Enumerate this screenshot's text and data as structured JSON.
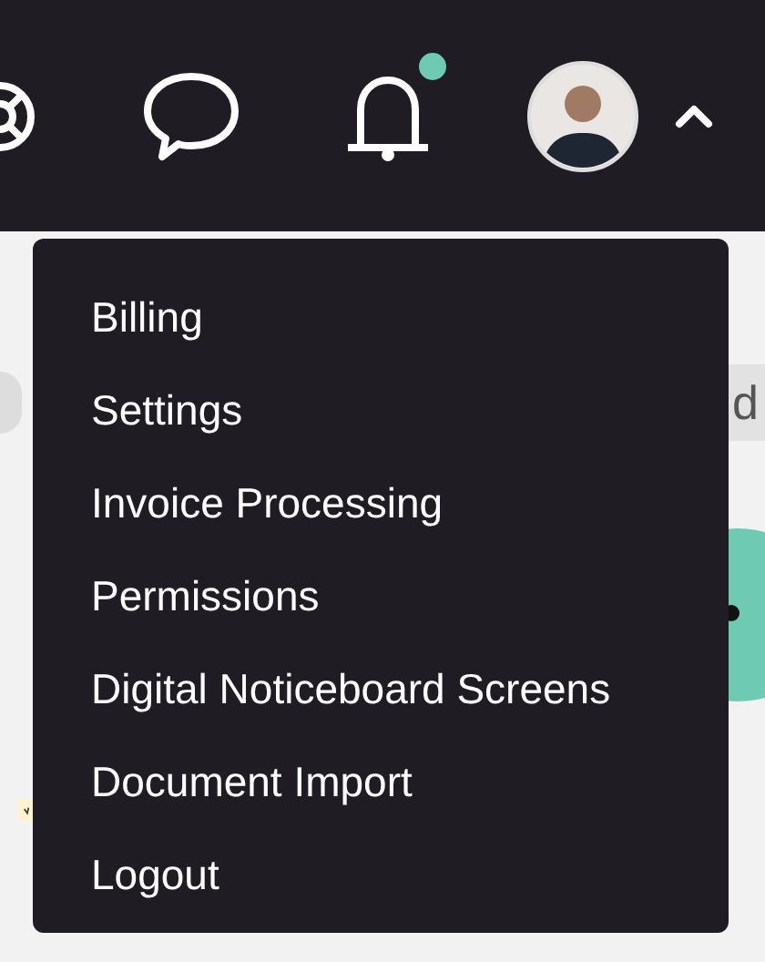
{
  "header": {
    "notifications_unread": true,
    "menu_expanded": true
  },
  "background": {
    "chip_text": "d"
  },
  "menu": {
    "items": [
      {
        "label": "Billing"
      },
      {
        "label": "Settings"
      },
      {
        "label": "Invoice Processing"
      },
      {
        "label": "Permissions"
      },
      {
        "label": "Digital Noticeboard Screens"
      },
      {
        "label": "Document Import"
      },
      {
        "label": "Logout"
      }
    ]
  }
}
